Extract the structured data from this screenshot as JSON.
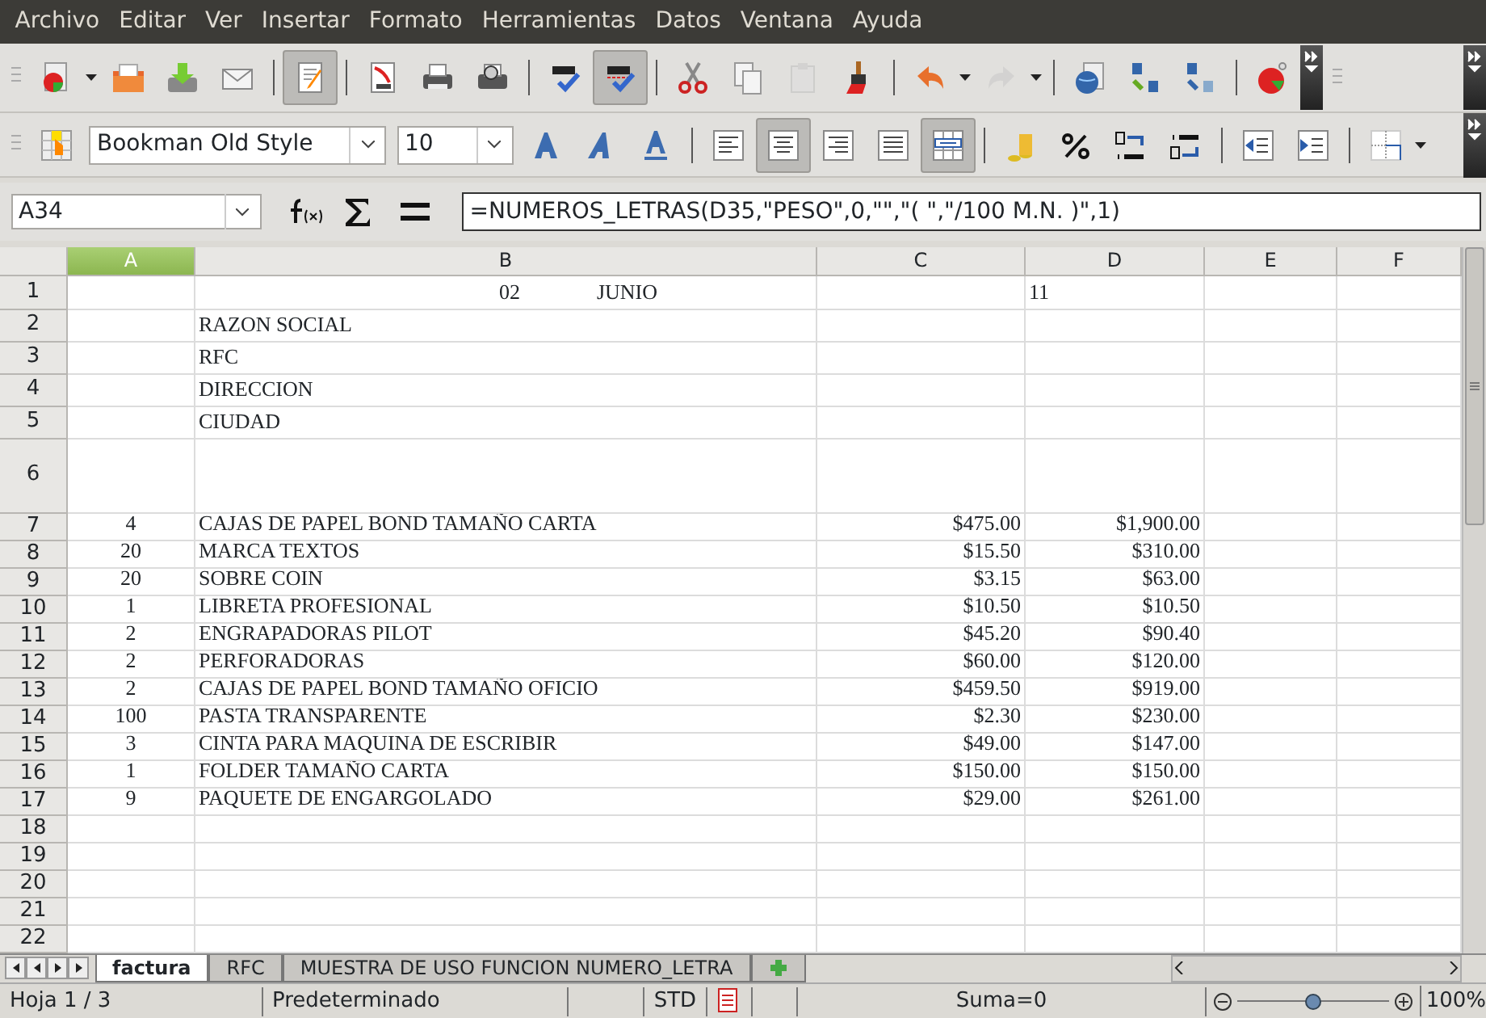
{
  "menu": [
    {
      "label": "Archivo"
    },
    {
      "label": "Editar"
    },
    {
      "label": "Ver"
    },
    {
      "label": "Insertar"
    },
    {
      "label": "Formato"
    },
    {
      "label": "Herramientas"
    },
    {
      "label": "Datos"
    },
    {
      "label": "Ventana"
    },
    {
      "label": "Ayuda"
    }
  ],
  "standard_toolbar": {
    "edit_file_pressed": true,
    "autospellcheck_pressed": true,
    "redo_disabled": true
  },
  "formatting_toolbar": {
    "font_name": "Bookman Old Style",
    "font_size": "10",
    "align_center_pressed": true,
    "merge_cells_pressed": true
  },
  "formula_bar": {
    "name_box": "A34",
    "formula": "=NUMEROS_LETRAS(D35,\"PESO\",0,\"\",\"( \",\"/100 M.N. )\",1)"
  },
  "columns": [
    {
      "label": "A",
      "selected": true
    },
    {
      "label": "B",
      "selected": false
    },
    {
      "label": "C",
      "selected": false
    },
    {
      "label": "D",
      "selected": false
    },
    {
      "label": "E",
      "selected": false
    },
    {
      "label": "F",
      "selected": false
    }
  ],
  "rows": [
    {
      "number": "1",
      "cells": [
        "",
        {
          "parts": [
            "02",
            "JUNIO"
          ]
        },
        "",
        {
          "text": "11",
          "kind": "text"
        },
        "",
        ""
      ]
    },
    {
      "number": "2",
      "cells": [
        "",
        "RAZON SOCIAL",
        "",
        "",
        "",
        ""
      ]
    },
    {
      "number": "3",
      "cells": [
        "",
        "RFC",
        "",
        "",
        "",
        ""
      ]
    },
    {
      "number": "4",
      "cells": [
        "",
        "DIRECCION",
        "",
        "",
        "",
        ""
      ]
    },
    {
      "number": "5",
      "cells": [
        "",
        "CIUDAD",
        "",
        "",
        "",
        ""
      ]
    },
    {
      "number": "6",
      "cells": [
        "",
        "",
        "",
        "",
        "",
        ""
      ]
    },
    {
      "number": "7",
      "cells": [
        "4",
        "CAJAS DE PAPEL BOND TAMAÑO CARTA",
        "$475.00",
        "$1,900.00",
        "",
        ""
      ]
    },
    {
      "number": "8",
      "cells": [
        "20",
        "MARCA TEXTOS",
        "$15.50",
        "$310.00",
        "",
        ""
      ]
    },
    {
      "number": "9",
      "cells": [
        "20",
        "SOBRE COIN",
        "$3.15",
        "$63.00",
        "",
        ""
      ]
    },
    {
      "number": "10",
      "cells": [
        "1",
        "LIBRETA PROFESIONAL",
        "$10.50",
        "$10.50",
        "",
        ""
      ]
    },
    {
      "number": "11",
      "cells": [
        "2",
        "ENGRAPADORAS PILOT",
        "$45.20",
        "$90.40",
        "",
        ""
      ]
    },
    {
      "number": "12",
      "cells": [
        "2",
        "PERFORADORAS",
        "$60.00",
        "$120.00",
        "",
        ""
      ]
    },
    {
      "number": "13",
      "cells": [
        "2",
        "CAJAS DE PAPEL BOND TAMAÑO OFICIO",
        "$459.50",
        "$919.00",
        "",
        ""
      ]
    },
    {
      "number": "14",
      "cells": [
        "100",
        "PASTA TRANSPARENTE",
        "$2.30",
        "$230.00",
        "",
        ""
      ]
    },
    {
      "number": "15",
      "cells": [
        "3",
        "CINTA PARA MAQUINA DE ESCRIBIR",
        "$49.00",
        "$147.00",
        "",
        ""
      ]
    },
    {
      "number": "16",
      "cells": [
        "1",
        "FOLDER TAMAÑO CARTA",
        "$150.00",
        "$150.00",
        "",
        ""
      ]
    },
    {
      "number": "17",
      "cells": [
        "9",
        "PAQUETE DE ENGARGOLADO",
        "$29.00",
        "$261.00",
        "",
        ""
      ]
    },
    {
      "number": "18",
      "cells": [
        "",
        "",
        "",
        "",
        "",
        ""
      ]
    },
    {
      "number": "19",
      "cells": [
        "",
        "",
        "",
        "",
        "",
        ""
      ]
    },
    {
      "number": "20",
      "cells": [
        "",
        "",
        "",
        "",
        "",
        ""
      ]
    },
    {
      "number": "21",
      "cells": [
        "",
        "",
        "",
        "",
        "",
        ""
      ]
    },
    {
      "number": "22",
      "cells": [
        "",
        "",
        "",
        "",
        "",
        ""
      ]
    }
  ],
  "sheet_tabs": [
    {
      "label": "factura",
      "selected": true
    },
    {
      "label": "RFC",
      "selected": false
    },
    {
      "label": "MUESTRA DE USO FUNCION NUMERO_LETRA",
      "selected": false
    }
  ],
  "status_bar": {
    "sheet": "Hoja 1 / 3",
    "page_style": "Predeterminado",
    "selection_mode": "STD",
    "sum": "Suma=0",
    "zoom": "100%",
    "zoom_slider": {
      "level": 0.5
    }
  }
}
